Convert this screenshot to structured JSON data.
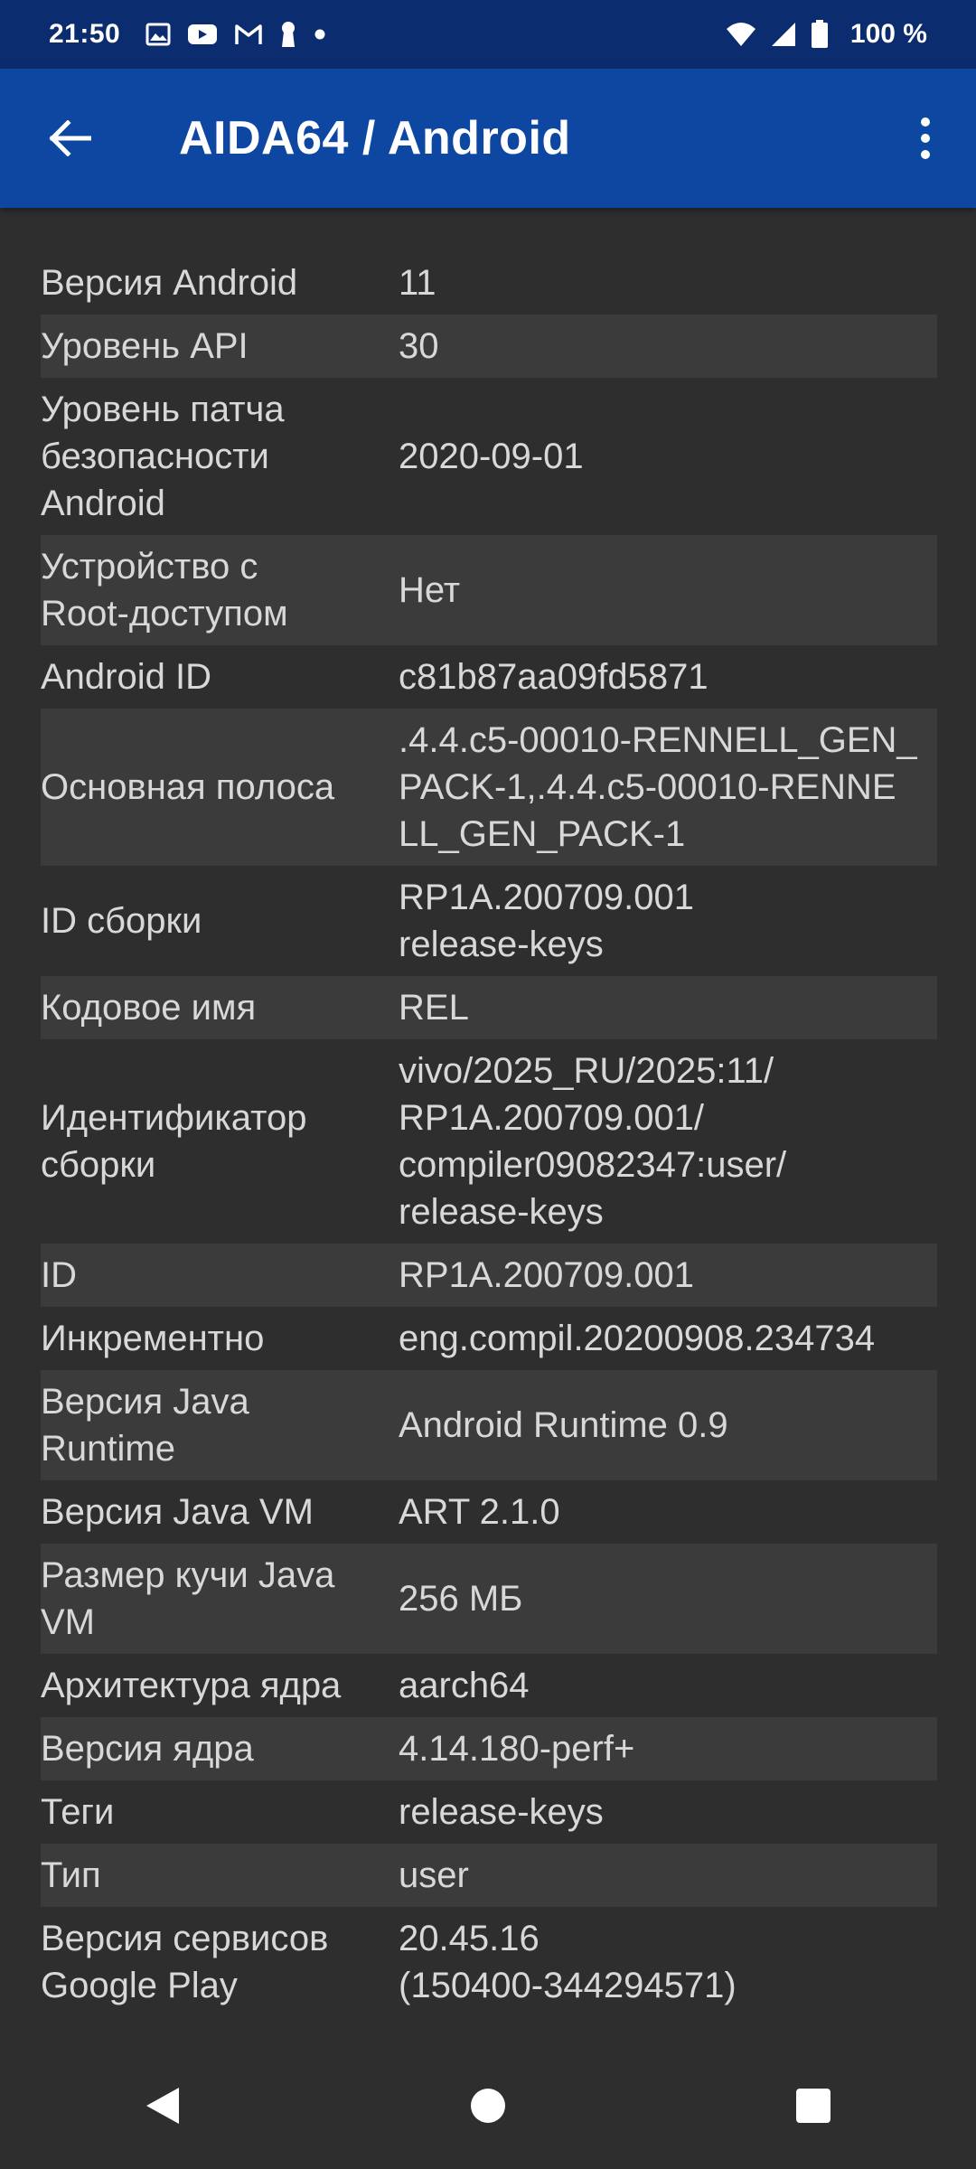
{
  "status_bar": {
    "time": "21:50",
    "battery_text": "100 %",
    "left_icons": [
      "gallery-icon",
      "youtube-icon",
      "gmail-icon",
      "keyhole-icon",
      "dot-icon"
    ],
    "right_icons": [
      "wifi-icon",
      "signal-icon",
      "battery-icon"
    ]
  },
  "app_bar": {
    "title": "AIDA64  /  Android",
    "back_icon": "arrow-left-icon",
    "menu_icon": "more-vert-icon"
  },
  "colors": {
    "status_bar": "#0b2c6e",
    "app_bar": "#0d47a1",
    "background": "#2e2e2e",
    "alt_row": "#3b3b3b",
    "text": "#d8d8d8"
  },
  "rows": [
    {
      "key": "Версия Android",
      "value": "11"
    },
    {
      "key": "Уровень API",
      "value": "30"
    },
    {
      "key": "Уровень патча\nбезопасности\nAndroid",
      "value": "2020-09-01"
    },
    {
      "key": "Устройство с\nRoot-доступом",
      "value": "Нет"
    },
    {
      "key": "Android ID",
      "value": "c81b87aa09fd5871"
    },
    {
      "key": "Основная полоса",
      "value": ".4.4.c5-00010-RENNELL_GEN_\nPACK-1,.4.4.c5-00010-RENNE\nLL_GEN_PACK-1"
    },
    {
      "key": "ID сборки",
      "value": "RP1A.200709.001\nrelease-keys"
    },
    {
      "key": "Кодовое имя",
      "value": "REL"
    },
    {
      "key": "Идентификатор\nсборки",
      "value": "vivo/2025_RU/2025:11/\nRP1A.200709.001/\ncompiler09082347:user/\nrelease-keys"
    },
    {
      "key": "ID",
      "value": "RP1A.200709.001"
    },
    {
      "key": "Инкрементно",
      "value": "eng.compil.20200908.234734"
    },
    {
      "key": "Версия Java\nRuntime",
      "value": "Android Runtime 0.9"
    },
    {
      "key": "Версия Java VM",
      "value": "ART 2.1.0"
    },
    {
      "key": "Размер кучи Java\nVM",
      "value": "256 МБ"
    },
    {
      "key": "Архитектура ядра",
      "value": "aarch64"
    },
    {
      "key": "Версия ядра",
      "value": "4.14.180-perf+"
    },
    {
      "key": "Теги",
      "value": "release-keys"
    },
    {
      "key": "Тип",
      "value": "user"
    },
    {
      "key": "Версия сервисов\nGoogle Play",
      "value": "20.45.16\n(150400-344294571)"
    }
  ],
  "nav_bar": {
    "back_icon": "nav-back-icon",
    "home_icon": "nav-home-icon",
    "recents_icon": "nav-recents-icon"
  }
}
